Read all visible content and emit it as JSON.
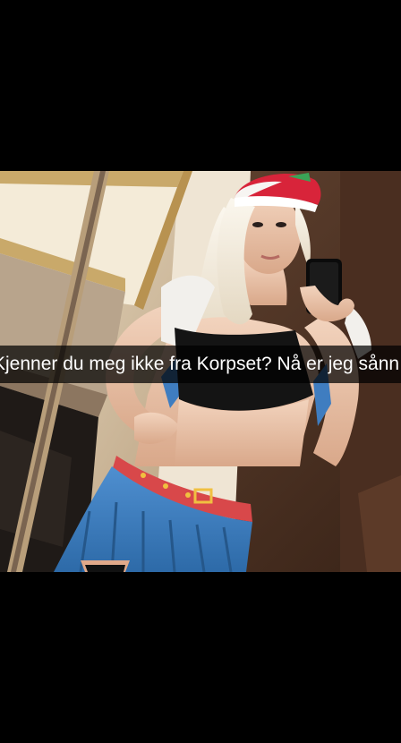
{
  "snap": {
    "caption": "Kjenner du meg ikke fra Korpset? Nå er jeg sånn",
    "photo_icon": "selfie-photo"
  },
  "colors": {
    "background": "#000000",
    "caption_bar": "rgba(0,0,0,0.72)",
    "caption_text": "#ffffff"
  }
}
